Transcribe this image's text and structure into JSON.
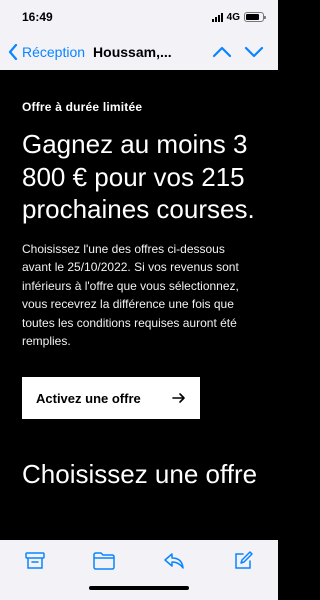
{
  "status": {
    "time": "16:49",
    "network": "4G",
    "battery_level": 0.8
  },
  "nav": {
    "back_label": "Réception",
    "title": "Houssam,..."
  },
  "email": {
    "eyebrow": "Offre à durée limitée",
    "headline": "Gagnez au moins 3 800 € pour vos 215 prochaines courses.",
    "body": "Choisissez l'une des offres ci-dessous avant le 25/10/2022. Si vos revenus sont inférieurs à l'offre que vous sélectionnez, vous recevrez la différence une fois que toutes les conditions requises auront été remplies.",
    "cta_label": "Activez une offre",
    "section_title": "Choisissez une offre"
  },
  "toolbar": {
    "icons": [
      "archive-icon",
      "folder-icon",
      "reply-icon",
      "compose-icon"
    ]
  },
  "colors": {
    "accent": "#0a84ff",
    "background": "#000000",
    "chrome": "#f2f2f7"
  }
}
